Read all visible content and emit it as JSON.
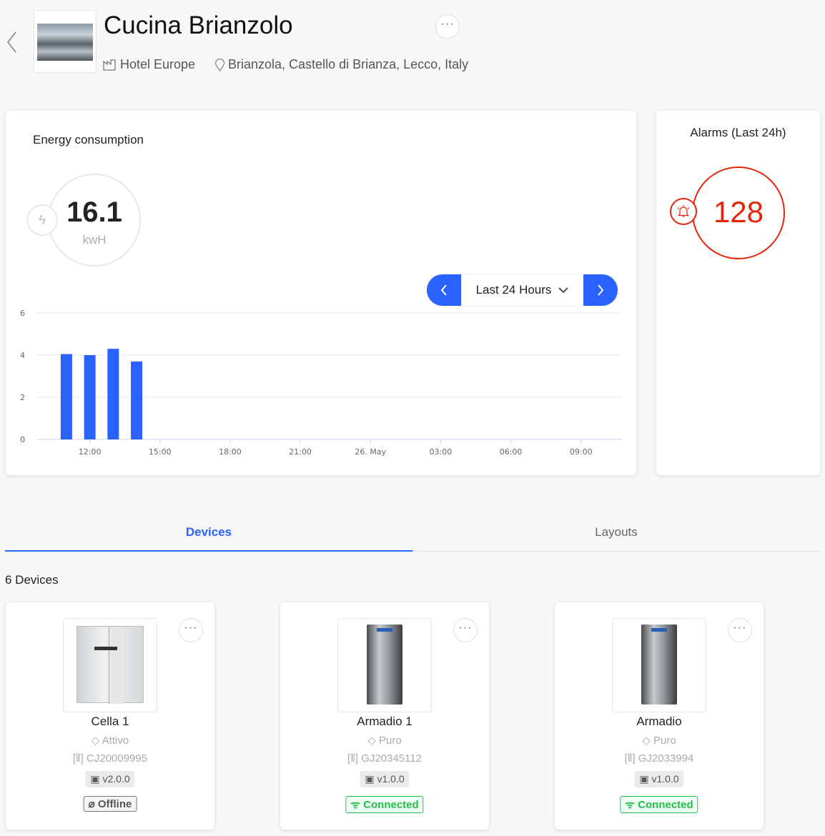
{
  "header": {
    "title": "Cucina Brianzolo",
    "group": "Hotel Europe",
    "address": "Brianzola, Castello di Brianza, Lecco, Italy",
    "more": "···"
  },
  "energy": {
    "title": "Energy consumption",
    "value": "16.1",
    "unit": "kwH",
    "period": "Last 24 Hours"
  },
  "alarms": {
    "title": "Alarms (Last 24h)",
    "count": "128",
    "color": "#e8230c"
  },
  "colors": {
    "accent": "#2962ff",
    "bar": "#2962ff",
    "online": "#1fbf4a"
  },
  "chart_data": {
    "type": "bar",
    "ylim": [
      0,
      6
    ],
    "yticks": [
      "0",
      "2",
      "4",
      "6"
    ],
    "xticks": [
      {
        "t": "25 May 12:00",
        "label": "12:00"
      },
      {
        "t": "25 May 15:00",
        "label": "15:00"
      },
      {
        "t": "25 May 18:00",
        "label": "18:00"
      },
      {
        "t": "25 May 21:00",
        "label": "21:00"
      },
      {
        "t": "26 May 00:00",
        "label": "26. May"
      },
      {
        "t": "26 May 03:00",
        "label": "03:00"
      },
      {
        "t": "26 May 06:00",
        "label": "06:00"
      },
      {
        "t": "26 May 09:00",
        "label": "09:00"
      }
    ],
    "xlim": [
      "25 May 09:45",
      "26 May 10:45"
    ],
    "x": [
      "25 May 11:00",
      "25 May 12:00",
      "25 May 13:00",
      "25 May 14:00"
    ],
    "values": [
      4.05,
      4.0,
      4.3,
      3.7
    ],
    "grid": true
  },
  "tabs": [
    {
      "label": "Devices",
      "active": true
    },
    {
      "label": "Layouts",
      "active": false
    }
  ],
  "devices_count": "6 Devices",
  "devices": [
    {
      "name": "Cella 1",
      "model": "Attivo",
      "serial": "CJ20009995",
      "version": "v2.0.0",
      "status": "Offline",
      "type": "cell"
    },
    {
      "name": "Armadio 1",
      "model": "Puro",
      "serial": "GJ20345112",
      "version": "v1.0.0",
      "status": "Connected",
      "type": "cabinet"
    },
    {
      "name": "Armadio",
      "model": "Puro",
      "serial": "GJ2033994",
      "version": "v1.0.0",
      "status": "Connected",
      "type": "cabinet"
    }
  ]
}
